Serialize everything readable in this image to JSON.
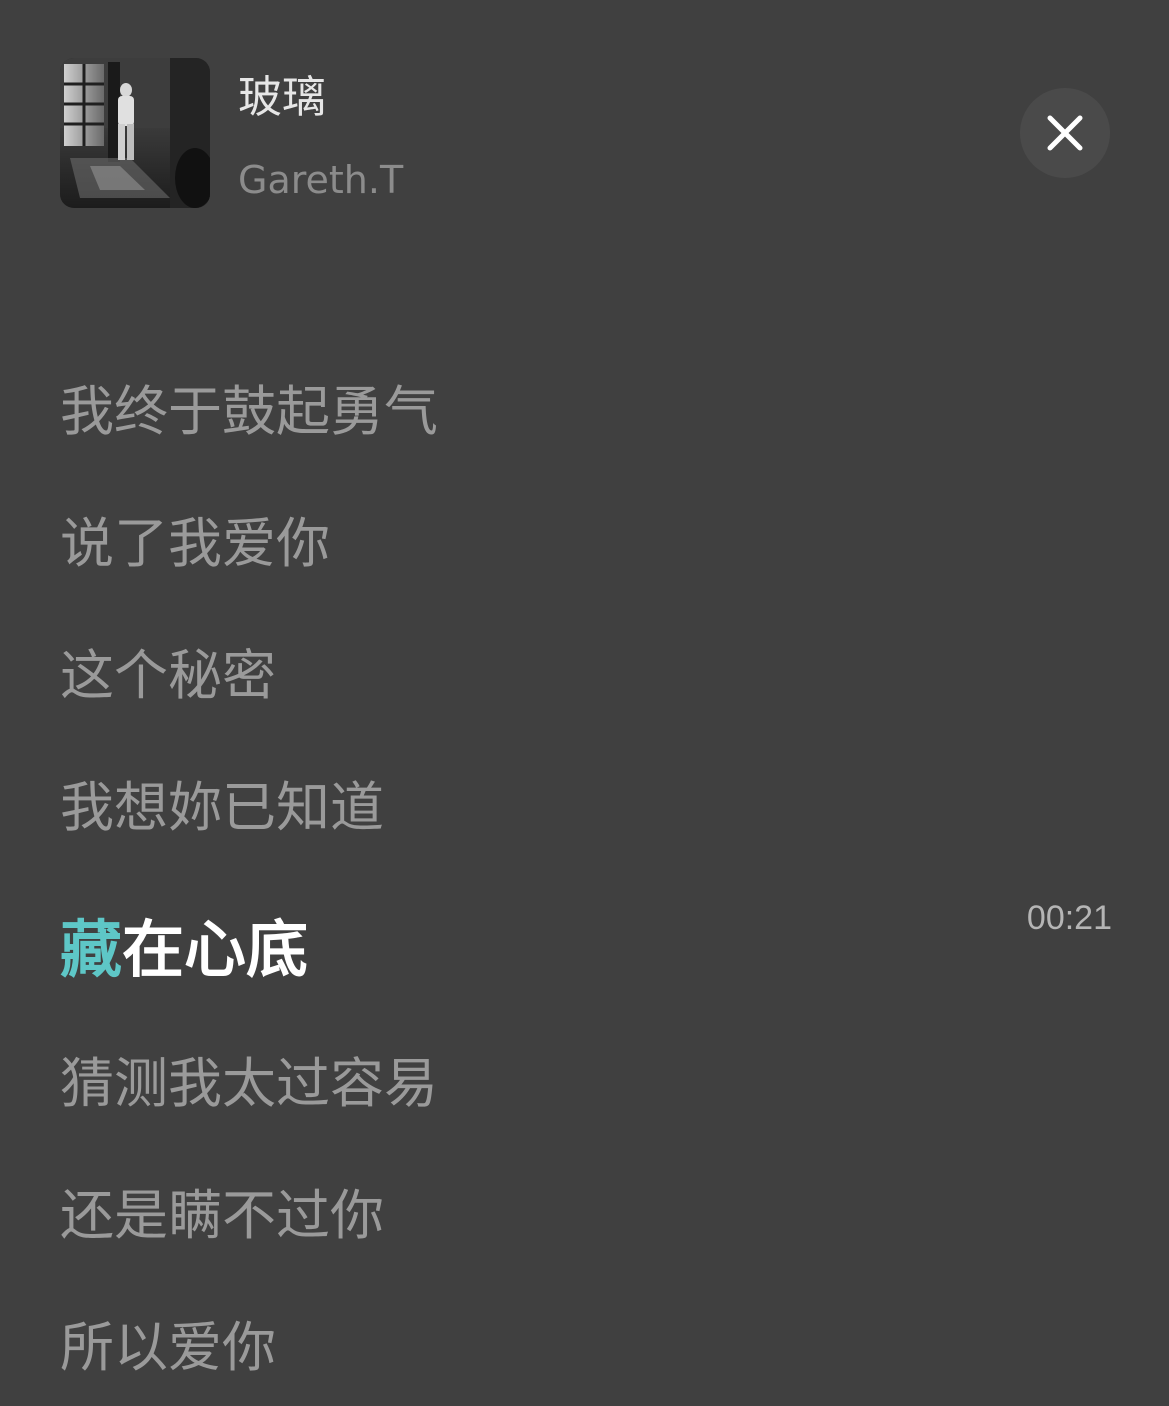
{
  "song": {
    "title": "玻璃",
    "artist": "Gareth.T",
    "cover_icon": "album-cover-image"
  },
  "controls": {
    "close_icon": "close-icon"
  },
  "lyrics": {
    "previous_faded": "",
    "lines_before": [
      "我终于鼓起勇气",
      "说了我爱你",
      "这个秘密",
      "我想妳已知道"
    ],
    "current": {
      "sung": "藏",
      "unsung": "在心底",
      "timestamp": "00:21"
    },
    "lines_after": [
      "猜测我太过容易",
      "还是瞒不过你",
      "所以爱你"
    ]
  },
  "colors": {
    "background": "#404040",
    "highlight": "#5ec7c7",
    "current_line": "#ffffff",
    "inactive_line": "#9a9a9a"
  }
}
